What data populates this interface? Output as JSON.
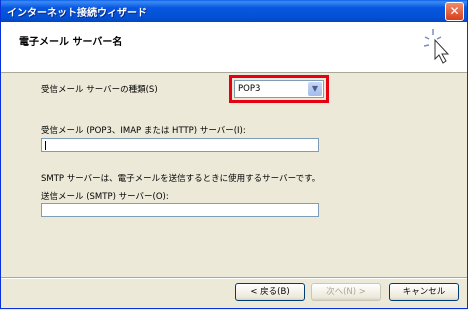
{
  "window": {
    "title": "インターネット接続ウィザード",
    "close_label": "✕"
  },
  "header": {
    "title": "電子メール サーバー名"
  },
  "form": {
    "server_type_label": "受信メール サーバーの種類(S)",
    "server_type_value": "POP3",
    "incoming_label": "受信メール (POP3、IMAP または HTTP) サーバー(I):",
    "incoming_value": "",
    "smtp_description": "SMTP サーバーは、電子メールを送信するときに使用するサーバーです。",
    "outgoing_label": "送信メール (SMTP) サーバー(O):",
    "outgoing_value": ""
  },
  "buttons": {
    "back": "< 戻る(B)",
    "next": "次へ(N) >",
    "cancel": "キャンセル"
  },
  "colors": {
    "highlight": "#e60012",
    "titlebar": "#0350d4"
  }
}
